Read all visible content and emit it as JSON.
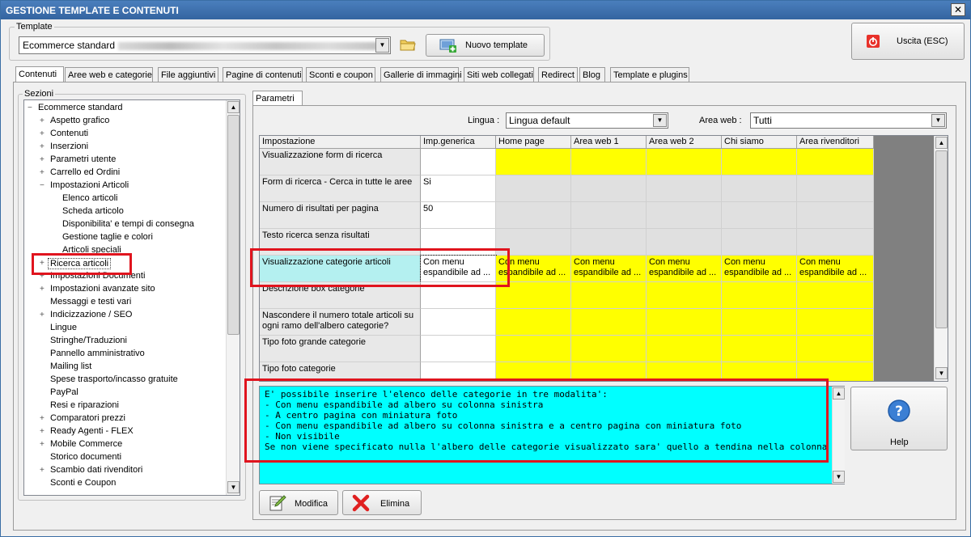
{
  "window": {
    "title": "GESTIONE TEMPLATE E CONTENUTI",
    "close_label": "✕"
  },
  "template": {
    "legend": "Template",
    "selected": "Ecommerce standard",
    "new_button": "Nuovo template"
  },
  "exit_button": "Uscita (ESC)",
  "tabs": [
    {
      "label": "Contenuti"
    },
    {
      "label": "Aree web e categorie"
    },
    {
      "label": "File aggiuntivi"
    },
    {
      "label": "Pagine di contenuti"
    },
    {
      "label": "Sconti e coupon"
    },
    {
      "label": "Gallerie di immagini"
    },
    {
      "label": "Siti web collegati"
    },
    {
      "label": "Redirect"
    },
    {
      "label": "Blog"
    },
    {
      "label": "Template e plugins"
    }
  ],
  "sections": {
    "legend": "Sezioni",
    "items": [
      {
        "label": "Ecommerce standard",
        "toggle": "−"
      },
      {
        "label": "Aspetto grafico",
        "toggle": "+"
      },
      {
        "label": "Contenuti",
        "toggle": "+"
      },
      {
        "label": "Inserzioni",
        "toggle": "+"
      },
      {
        "label": "Parametri utente",
        "toggle": "+"
      },
      {
        "label": "Carrello ed Ordini",
        "toggle": "+"
      },
      {
        "label": "Impostazioni Articoli",
        "toggle": "−"
      },
      {
        "label": "Elenco articoli",
        "toggle": ""
      },
      {
        "label": "Scheda articolo",
        "toggle": ""
      },
      {
        "label": "Disponibilita' e tempi di consegna",
        "toggle": ""
      },
      {
        "label": "Gestione taglie e colori",
        "toggle": ""
      },
      {
        "label": "Articoli speciali",
        "toggle": ""
      },
      {
        "label": "Ricerca articoli",
        "toggle": "+"
      },
      {
        "label": "Impostazioni Documenti",
        "toggle": "+"
      },
      {
        "label": "Impostazioni avanzate sito",
        "toggle": "+"
      },
      {
        "label": "Messaggi e testi vari",
        "toggle": ""
      },
      {
        "label": "Indicizzazione / SEO",
        "toggle": "+"
      },
      {
        "label": "Lingue",
        "toggle": ""
      },
      {
        "label": "Stringhe/Traduzioni",
        "toggle": ""
      },
      {
        "label": "Pannello amministrativo",
        "toggle": ""
      },
      {
        "label": "Mailing list",
        "toggle": ""
      },
      {
        "label": "Spese trasporto/incasso gratuite",
        "toggle": ""
      },
      {
        "label": "PayPal",
        "toggle": ""
      },
      {
        "label": "Resi e riparazioni",
        "toggle": ""
      },
      {
        "label": "Comparatori prezzi",
        "toggle": "+"
      },
      {
        "label": "Ready Agenti - FLEX",
        "toggle": "+"
      },
      {
        "label": "Mobile Commerce",
        "toggle": "+"
      },
      {
        "label": "Storico documenti",
        "toggle": ""
      },
      {
        "label": "Scambio dati rivenditori",
        "toggle": "+"
      },
      {
        "label": "Sconti e Coupon",
        "toggle": ""
      }
    ]
  },
  "params": {
    "tab_label": "Parametri",
    "lingua_label": "Lingua :",
    "lingua_value": "Lingua default",
    "area_label": "Area web :",
    "area_value": "Tutti"
  },
  "grid": {
    "headers": [
      "Impostazione",
      "Imp.generica",
      "Home page",
      "Area web 1",
      "Area web 2",
      "Chi siamo",
      "Area rivenditori"
    ],
    "rows": [
      {
        "label": "Visualizzazione form di ricerca",
        "values": [
          "",
          "",
          "",
          "",
          "",
          ""
        ]
      },
      {
        "label": "Form di ricerca - Cerca in tutte le aree",
        "values": [
          "Si",
          "",
          "",
          "",
          "",
          ""
        ]
      },
      {
        "label": "Numero di risultati per pagina",
        "values": [
          "50",
          "",
          "",
          "",
          "",
          ""
        ]
      },
      {
        "label": "Testo ricerca senza risultati",
        "values": [
          "",
          "",
          "",
          "",
          "",
          ""
        ]
      },
      {
        "label": "Visualizzazione categorie articoli",
        "values": [
          "Con menu espandibile ad ...",
          "Con menu espandibile ad ...",
          "Con menu espandibile ad ...",
          "Con menu espandibile ad ...",
          "Con menu espandibile ad ...",
          "Con menu espandibile ad ..."
        ]
      },
      {
        "label": "Descrizione box categorie",
        "values": [
          "",
          "",
          "",
          "",
          "",
          ""
        ]
      },
      {
        "label": "Nascondere il numero totale articoli su ogni ramo dell'albero categorie?",
        "values": [
          "",
          "",
          "",
          "",
          "",
          ""
        ]
      },
      {
        "label": "Tipo foto grande categorie",
        "values": [
          "",
          "",
          "",
          "",
          "",
          ""
        ]
      },
      {
        "label": "Tipo foto categorie",
        "values": [
          "",
          "",
          "",
          "",
          "",
          ""
        ]
      }
    ]
  },
  "description": "E' possibile inserire l'elenco delle categorie in tre modalita':\n- Con menu espandibile ad albero su colonna sinistra\n- A centro pagina con miniatura foto\n- Con menu espandibile ad albero su colonna sinistra e a centro pagina con miniatura foto\n- Non visibile\nSe non viene specificato nulla l'albero delle categorie visualizzato sara' quello a tendina nella colonna sinistra",
  "buttons": {
    "help": "Help",
    "modifica": "Modifica",
    "elimina": "Elimina"
  },
  "colors": {
    "highlight_yellow": "#ffff00",
    "selected_cyan": "#b4f0f0",
    "desc_bg": "#00ffff",
    "annotation_red": "#e0141e"
  }
}
